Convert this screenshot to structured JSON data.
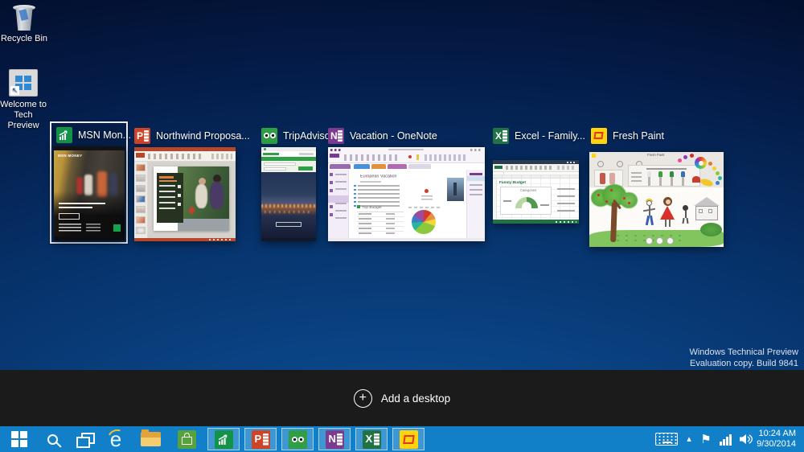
{
  "desktop": {
    "icons": [
      {
        "label": "Recycle Bin"
      },
      {
        "label": "Welcome to Tech Preview"
      }
    ],
    "watermark": {
      "line1": "Windows Technical Preview",
      "line2": "Evaluation copy. Build 9841"
    }
  },
  "task_view": {
    "add_desktop_label": "Add a desktop",
    "windows": [
      {
        "title": "MSN Mon...",
        "app": "MSN Money",
        "selected": true,
        "content": {
          "brand": "MSN MONEY"
        }
      },
      {
        "title": "Northwind Proposa...",
        "app": "PowerPoint"
      },
      {
        "title": "TripAdvisor...",
        "app": "TripAdvisor"
      },
      {
        "title": "Vacation - OneNote",
        "app": "OneNote",
        "content": {
          "heading": "European Vacation",
          "table_title": "Trip Budget"
        }
      },
      {
        "title": "Excel - Family...",
        "app": "Excel",
        "content": {
          "heading": "Family Budget",
          "chart_title": "Categories"
        }
      },
      {
        "title": "Fresh Paint",
        "app": "Fresh Paint",
        "content": {
          "titlebar": "Fresh Paint"
        }
      }
    ]
  },
  "taskbar": {
    "pinned_icons": [
      "start",
      "search",
      "task-view",
      "internet-explorer",
      "file-explorer",
      "store"
    ],
    "running_icons": [
      "msn-money",
      "powerpoint",
      "tripadvisor",
      "onenote",
      "excel",
      "fresh-paint"
    ],
    "tray_icons": [
      "keyboard",
      "show-hidden-chevron",
      "action-center-flag",
      "network-signal",
      "volume"
    ],
    "clock": {
      "time": "10:24 AM",
      "date": "9/30/2014"
    }
  },
  "glyphs": {
    "powerpoint_letter": "P",
    "onenote_letter": "N",
    "excel_letter": "X",
    "ie_letter": "e",
    "plus": "+",
    "chevron_up": "▴",
    "flag": "⚑",
    "shortcut_arrow": "↖"
  },
  "colors": {
    "taskbar": "#1280c8",
    "task_view_strip": "#1b1b1b",
    "msn_green": "#13934a",
    "powerpoint_red": "#cf4326",
    "tripadvisor_green": "#2f9e44",
    "onenote_purple": "#7d3a91",
    "excel_green": "#217346",
    "freshpaint_yellow": "#ffd40a"
  }
}
